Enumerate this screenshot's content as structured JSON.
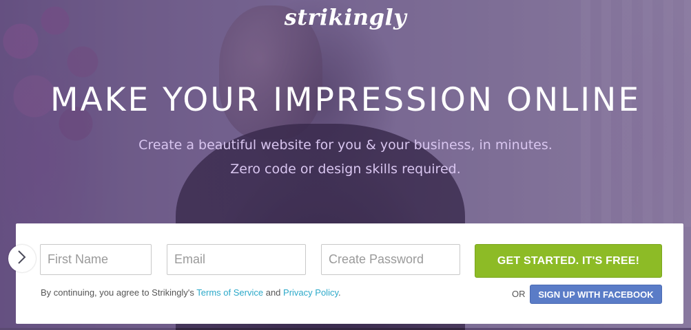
{
  "brand": {
    "logo_text": "strikingly"
  },
  "hero": {
    "headline": "MAKE YOUR IMPRESSION ONLINE",
    "subline_1": "Create a beautiful website for you & your business, in minutes.",
    "subline_2": "Zero code or design skills required."
  },
  "signup": {
    "first_name_placeholder": "First Name",
    "email_placeholder": "Email",
    "password_placeholder": "Create Password",
    "cta_label": "GET STARTED. IT'S FREE!",
    "terms_prefix": "By continuing, you agree to Strikingly's",
    "terms_link": "Terms of Service",
    "terms_and": "and",
    "privacy_link": "Privacy Policy",
    "terms_suffix": ".",
    "or_label": "OR",
    "facebook_label": "SIGN UP WITH FACEBOOK",
    "arrow_icon": "chevron-right-icon"
  },
  "colors": {
    "cta_green": "#8dbb26",
    "facebook_blue": "#5a7cc7",
    "link_cyan": "#2ca9c9",
    "subline_lavender": "#d9c6f0"
  }
}
